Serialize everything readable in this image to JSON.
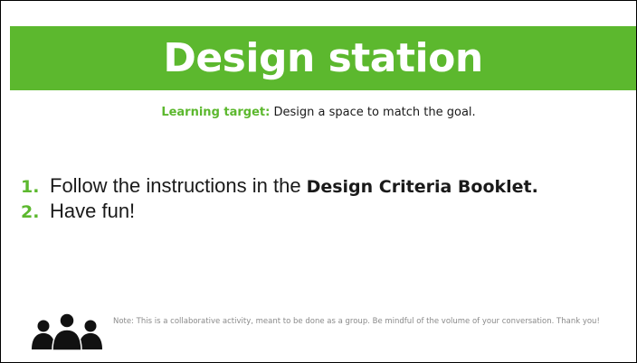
{
  "header": {
    "title": "Design station",
    "accent_color": "#5cb82e"
  },
  "learning_target": {
    "label": "Learning target:",
    "text": " Design a space to match the goal."
  },
  "steps": [
    {
      "number": "1.",
      "text": "Follow the instructions in the",
      "bold_text": "Design Criteria Booklet."
    },
    {
      "number": "2.",
      "text": "Have fun!",
      "bold_text": ""
    }
  ],
  "footer": {
    "icon": "group-icon",
    "note": "Note: This is a collaborative activity, meant to be done as a group. Be mindful of the volume of your conversation. Thank you!"
  }
}
